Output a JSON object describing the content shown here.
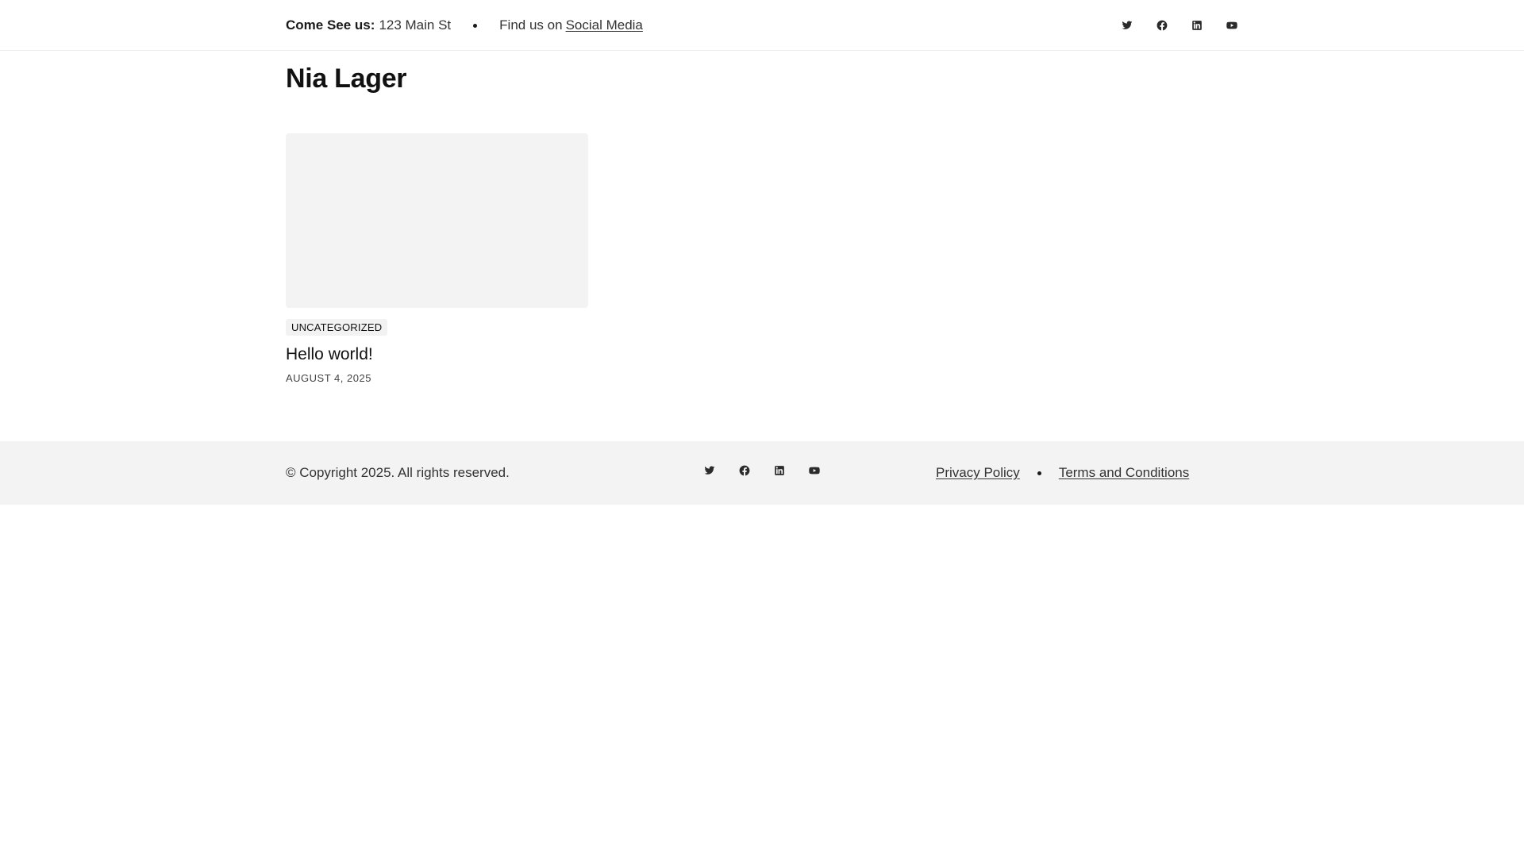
{
  "topbar": {
    "visit_label": "Come See us:",
    "address": "123 Main St",
    "find_text": "Find us on",
    "social_link": "Social Media",
    "social_icons": [
      "twitter-icon",
      "facebook-icon",
      "linkedin-icon",
      "youtube-icon"
    ]
  },
  "site": {
    "title": "Nia Lager"
  },
  "post": {
    "category": "UNCATEGORIZED",
    "title": "Hello world!",
    "date": "AUGUST 4, 2025"
  },
  "footer": {
    "copyright": "© Copyright 2025. All rights reserved.",
    "social_icons": [
      "twitter-icon",
      "facebook-icon",
      "linkedin-icon",
      "youtube-icon"
    ],
    "links": [
      "Privacy Policy",
      "Terms and Conditions"
    ]
  },
  "colors": {
    "text": "#1a1a1a",
    "muted": "#333333",
    "panel": "#f3f3f3",
    "border": "#ececec"
  }
}
